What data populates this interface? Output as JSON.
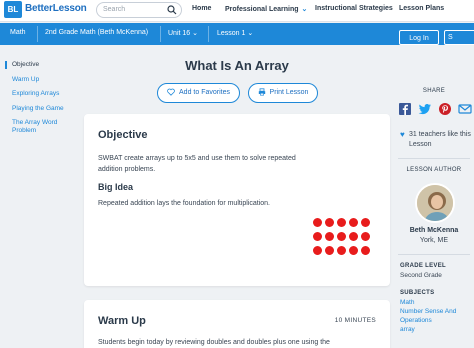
{
  "header": {
    "logo_mark": "BL",
    "logo_text": "BetterLesson",
    "search_placeholder": "Search",
    "nav": [
      {
        "label": "Home"
      },
      {
        "label": "Professional Learning"
      },
      {
        "label": "Instructional Strategies"
      },
      {
        "label": "Lesson Plans"
      }
    ]
  },
  "subbar": {
    "crumbs": [
      "Math",
      "2nd Grade Math (Beth McKenna)",
      "Unit 16",
      "Lesson 1"
    ],
    "login_label": "Log In",
    "signup_label": "S"
  },
  "sidebar": {
    "items": [
      {
        "label": "Objective"
      },
      {
        "label": "Warm Up"
      },
      {
        "label": "Exploring Arrays"
      },
      {
        "label": "Playing the Game"
      },
      {
        "label": "The Array Word Problem"
      }
    ]
  },
  "main": {
    "title": "What Is An Array",
    "add_favorites_label": "Add to Favorites",
    "print_label": "Print Lesson",
    "objective": {
      "heading": "Objective",
      "text": "SWBAT create arrays up to 5x5 and use them to solve repeated addition problems.",
      "big_idea_heading": "Big Idea",
      "big_idea_text": "Repeated addition lays the foundation for multiplication.",
      "dot_rows": 3,
      "dot_cols": 5
    },
    "warmup": {
      "heading": "Warm Up",
      "minutes": "10 MINUTES",
      "text": "Students begin today by reviewing doubles and doubles plus one using the"
    }
  },
  "rightcol": {
    "share_label": "SHARE",
    "favorites_text": "31 teachers like this Lesson",
    "author_label": "LESSON AUTHOR",
    "author_name": "Beth McKenna",
    "author_location": "York, ME",
    "grade_heading": "GRADE LEVEL",
    "grade_value": "Second Grade",
    "subjects_heading": "SUBJECTS",
    "subjects": [
      "Math",
      "Number Sense And Operations",
      "array"
    ]
  },
  "colors": {
    "brand_blue": "#1e88d8",
    "dot_red": "#e81c1c",
    "facebook": "#3b5998",
    "twitter": "#1da1f2",
    "pinterest": "#cb2027"
  },
  "icons": [
    "search-icon",
    "chevron-down-icon",
    "heart-icon",
    "print-icon",
    "facebook-icon",
    "twitter-icon",
    "pinterest-icon",
    "email-icon"
  ]
}
